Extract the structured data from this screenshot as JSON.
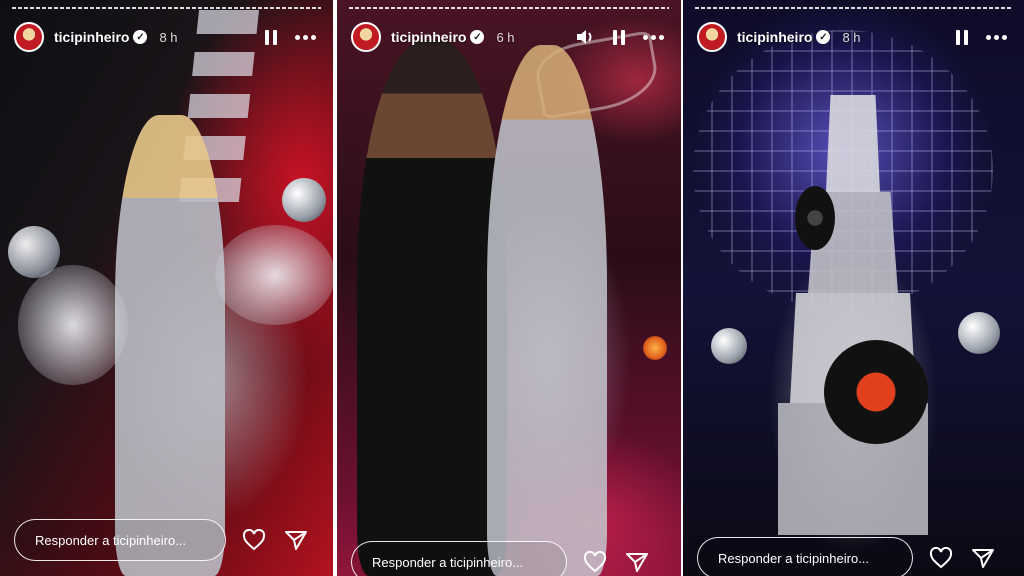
{
  "stories": [
    {
      "username": "ticipinheiro",
      "time": "8 h",
      "reply_placeholder": "Responder a ticipinheiro...",
      "controls": {
        "playback_icon": "pause-icon",
        "more_icon": "more-icon",
        "like_icon": "heart-icon",
        "share_icon": "send-icon"
      }
    },
    {
      "username": "ticipinheiro",
      "time": "6 h",
      "reply_placeholder": "Responder a ticipinheiro...",
      "controls": {
        "sound_icon": "volume-icon",
        "playback_icon": "pause-icon",
        "more_icon": "more-icon",
        "like_icon": "heart-icon",
        "share_icon": "send-icon"
      }
    },
    {
      "username": "ticipinheiro",
      "time": "8 h",
      "reply_placeholder": "Responder a ticipinheiro...",
      "controls": {
        "playback_icon": "pause-icon",
        "more_icon": "more-icon",
        "like_icon": "heart-icon",
        "share_icon": "send-icon"
      }
    }
  ],
  "colors": {
    "story1_accent": "#b3121f",
    "story2_accent": "#6b1030",
    "story3_accent": "#141238",
    "record_label": "#e0401c"
  }
}
